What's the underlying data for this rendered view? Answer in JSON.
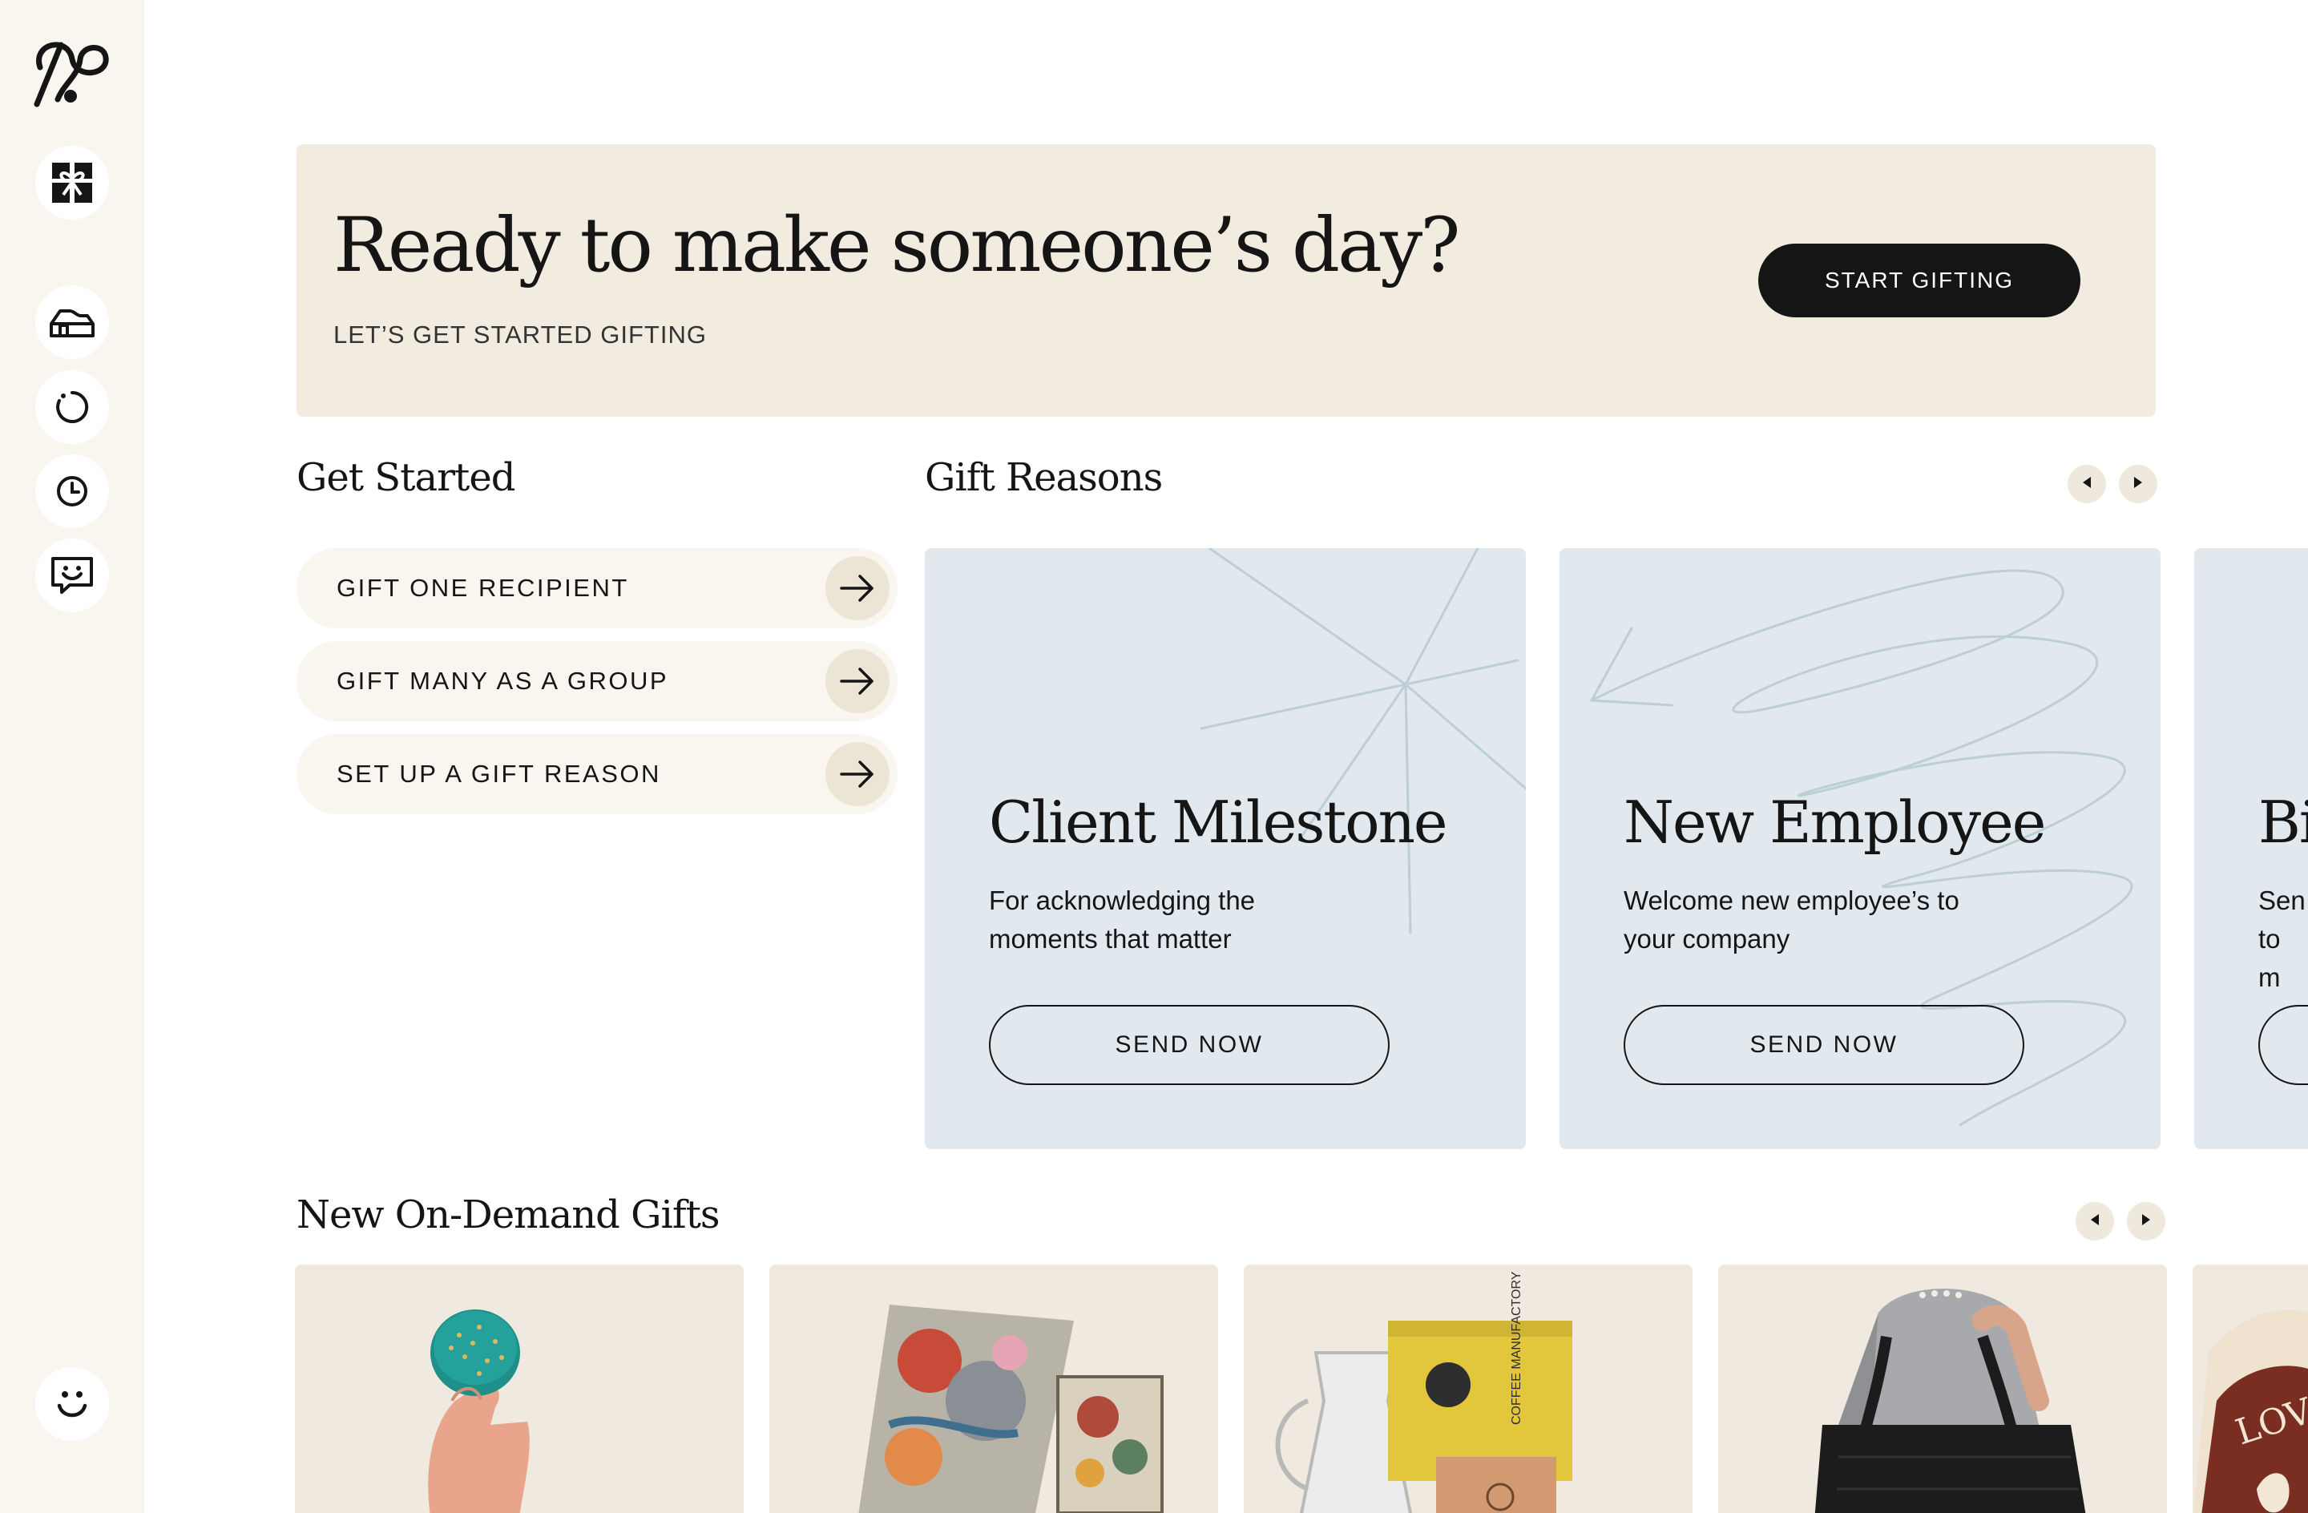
{
  "hero": {
    "title": "Ready to make someone’s day?",
    "subtitle": "LET’S GET STARTED GIFTING",
    "cta_label": "START GIFTING"
  },
  "get_started": {
    "title": "Get Started",
    "items": [
      {
        "label": "GIFT ONE RECIPIENT"
      },
      {
        "label": "GIFT MANY AS A GROUP"
      },
      {
        "label": "SET UP A GIFT REASON"
      }
    ]
  },
  "gift_reasons": {
    "title": "Gift Reasons",
    "cards": [
      {
        "title": "Client Milestone",
        "description": "For acknowledging the moments that matter",
        "button": "SEND NOW"
      },
      {
        "title": "New Employee",
        "description": "Welcome new employee’s to your company",
        "button": "SEND NOW"
      },
      {
        "title": "Bi",
        "description": "Sen to m",
        "button": ""
      }
    ]
  },
  "on_demand": {
    "title": "New On-Demand Gifts",
    "gifts": [
      {
        "name": "macaron-gift",
        "image": "hand-holding-macaron"
      },
      {
        "name": "puzzle-gift",
        "image": "art-puzzle-and-box"
      },
      {
        "name": "coffee-gift",
        "image": "coffee-bags-and-carafe"
      },
      {
        "name": "tote-bag-gift",
        "image": "person-with-black-tote"
      },
      {
        "name": "snack-bag-gift",
        "image": "printed-drawstring-bag",
        "label": "LOVE"
      }
    ]
  },
  "sidebar": {
    "icons": [
      "logo-icon",
      "gift-icon",
      "home-icon",
      "loading-icon",
      "clock-icon",
      "message-smile-icon",
      "smiley-icon"
    ]
  },
  "colors": {
    "sidebar_bg": "#f9f6f0",
    "hero_bg": "#f1ebe0",
    "card_bg": "#e2e9ee",
    "dark": "#151515"
  }
}
